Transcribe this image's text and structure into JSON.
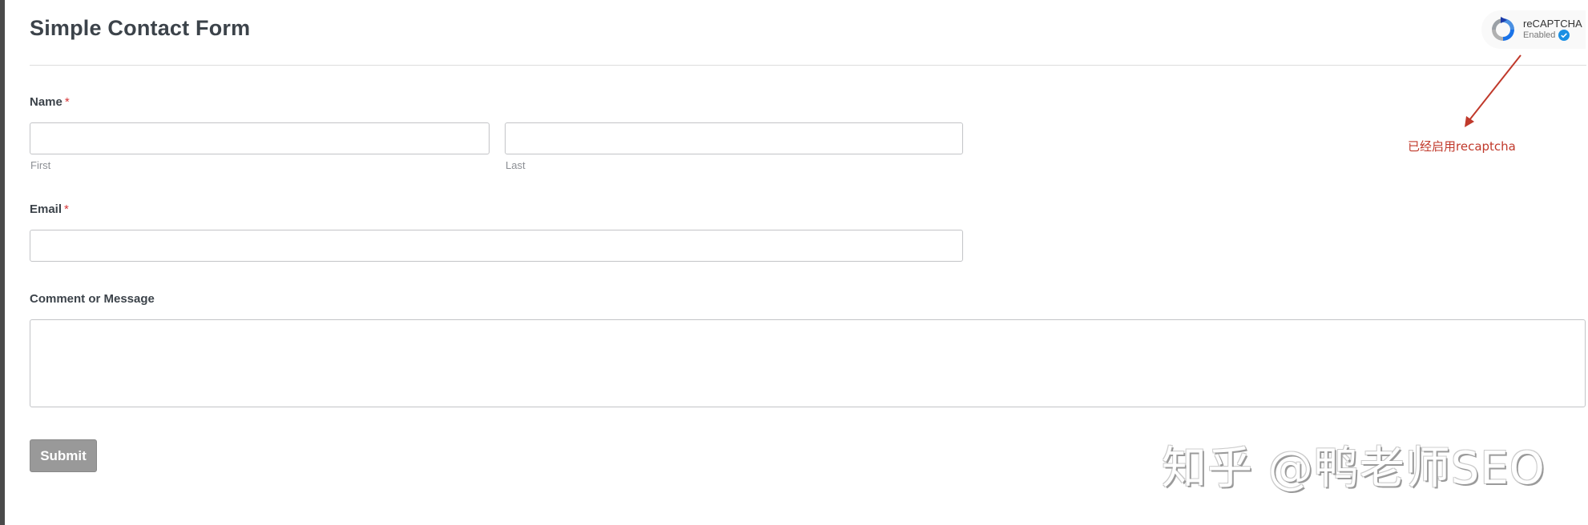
{
  "form": {
    "title": "Simple Contact Form",
    "name_field": {
      "label": "Name",
      "required_mark": "*",
      "first_value": "",
      "last_value": "",
      "first_sublabel": "First",
      "last_sublabel": "Last"
    },
    "email_field": {
      "label": "Email",
      "required_mark": "*",
      "value": ""
    },
    "message_field": {
      "label": "Comment or Message",
      "value": ""
    },
    "submit_label": "Submit"
  },
  "recaptcha": {
    "name": "reCAPTCHA",
    "status": "Enabled",
    "logo_icon": "recaptcha-logo-icon",
    "check_icon": "verified-check-icon"
  },
  "annotation": {
    "text": "已经启用recaptcha",
    "color": "#c0392b"
  },
  "watermark": {
    "text": "知乎 @鸭老师SEO"
  },
  "colors": {
    "required": "#d63638",
    "submit_bg": "#999999",
    "input_border": "#c3c4c7"
  }
}
